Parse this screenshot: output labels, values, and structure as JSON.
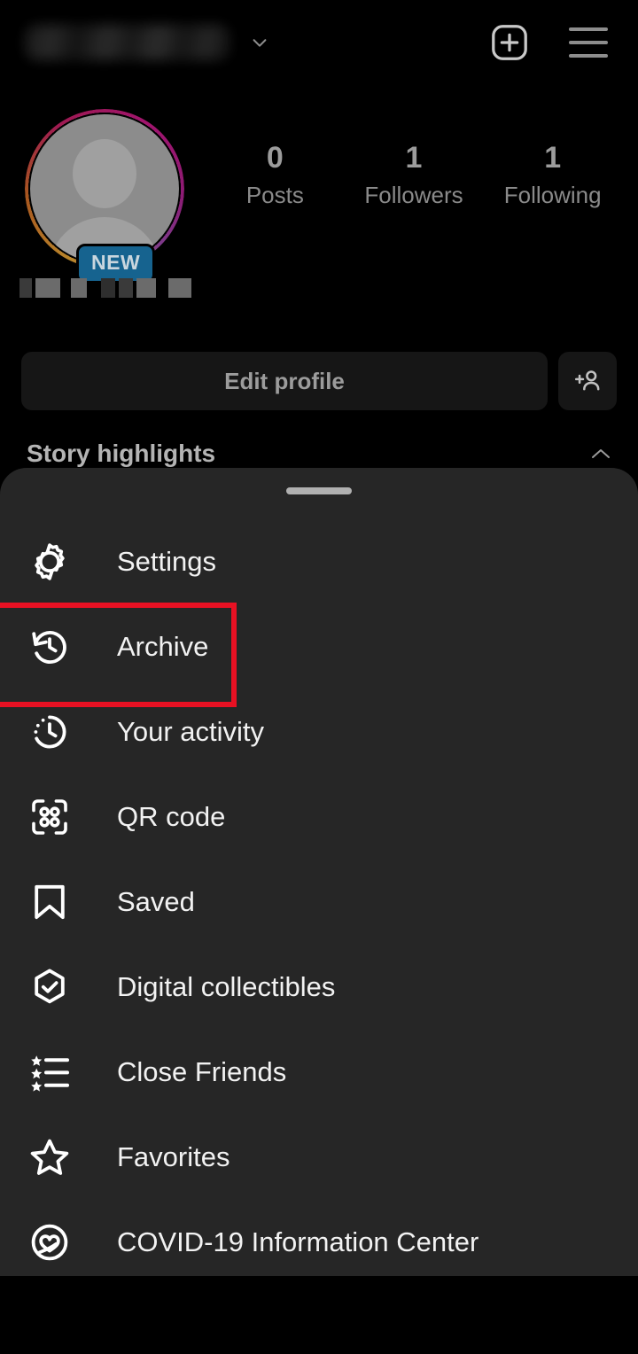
{
  "header": {
    "username_redacted": true,
    "chevron_icon": "chevron-down-icon",
    "new_post_icon": "plus-square-icon",
    "menu_icon": "hamburger-menu-icon"
  },
  "profile": {
    "avatar_icon": "default-avatar-icon",
    "story_ring": true,
    "story_ring_colors": [
      "#b8862b",
      "#a0156e"
    ],
    "new_badge_label": "NEW",
    "new_badge_color": "#16638f",
    "name_redacted": true,
    "stats": [
      {
        "value": "0",
        "label": "Posts"
      },
      {
        "value": "1",
        "label": "Followers"
      },
      {
        "value": "1",
        "label": "Following"
      }
    ]
  },
  "actions": {
    "edit_profile_label": "Edit profile",
    "add_person_icon": "add-person-icon"
  },
  "highlights": {
    "title": "Story highlights",
    "collapse_icon": "chevron-up-icon"
  },
  "sheet": {
    "handle": "drag-handle",
    "background": "#262626",
    "highlight_color": "#e81123",
    "items": [
      {
        "label": "Settings",
        "icon": "gear-icon",
        "highlighted": false
      },
      {
        "label": "Archive",
        "icon": "archive-clock-icon",
        "highlighted": true
      },
      {
        "label": "Your activity",
        "icon": "activity-clock-icon",
        "highlighted": false
      },
      {
        "label": "QR code",
        "icon": "qr-code-icon",
        "highlighted": false
      },
      {
        "label": "Saved",
        "icon": "bookmark-icon",
        "highlighted": false
      },
      {
        "label": "Digital collectibles",
        "icon": "hexagon-check-icon",
        "highlighted": false
      },
      {
        "label": "Close Friends",
        "icon": "star-list-icon",
        "highlighted": false
      },
      {
        "label": "Favorites",
        "icon": "star-icon",
        "highlighted": false
      },
      {
        "label": "COVID-19 Information Center",
        "icon": "covid-heart-icon",
        "highlighted": false
      }
    ]
  }
}
